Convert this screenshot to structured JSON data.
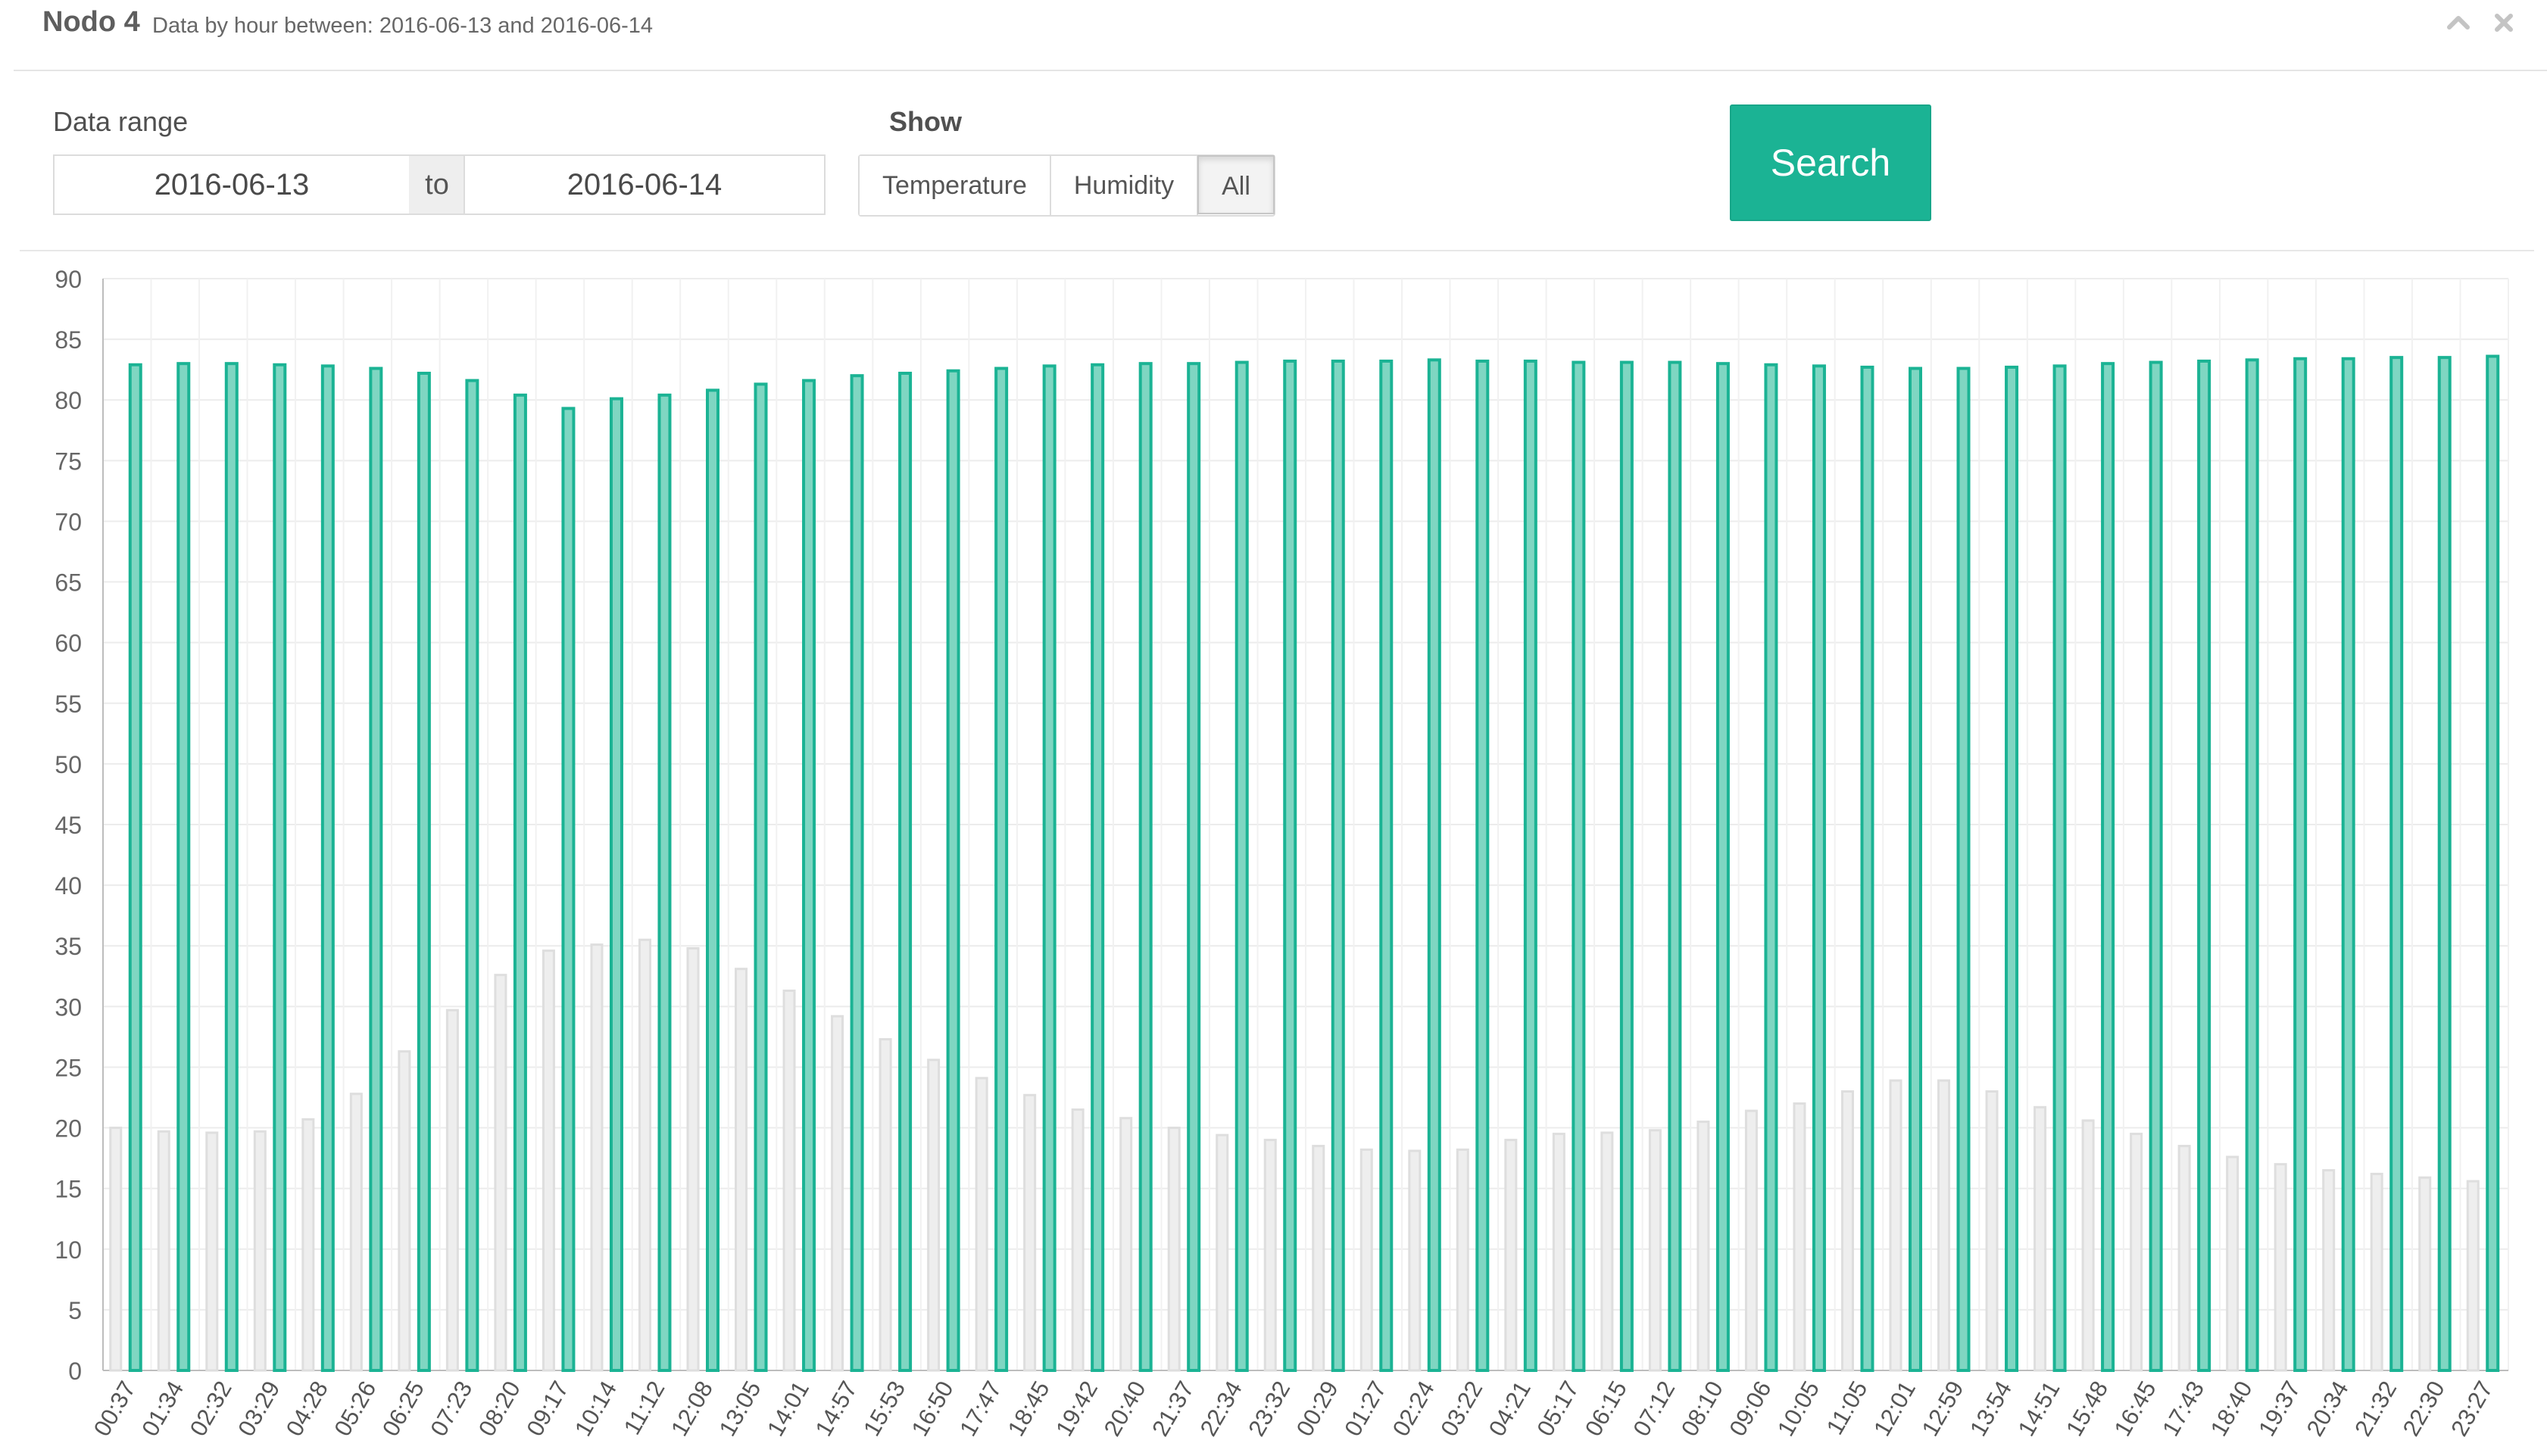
{
  "header": {
    "title": "Nodo 4",
    "subtitle": "Data by hour between: 2016-06-13 and 2016-06-14",
    "collapse_icon": "chevron-up-icon",
    "close_icon": "close-icon"
  },
  "form": {
    "range_label": "Data range",
    "from_value": "2016-06-13",
    "to_label": "to",
    "to_value": "2016-06-14",
    "show_label": "Show",
    "options": [
      "Temperature",
      "Humidity",
      "All"
    ],
    "selected": "All",
    "search_label": "Search"
  },
  "colors": {
    "humidity": "#1bb394",
    "temperature": "#dedede",
    "accent": "#1bb394"
  },
  "chart_data": {
    "type": "bar",
    "ylim": [
      0,
      90
    ],
    "yticks": [
      0,
      5,
      10,
      15,
      20,
      25,
      30,
      35,
      40,
      45,
      50,
      55,
      60,
      65,
      70,
      75,
      80,
      85,
      90
    ],
    "grid": true,
    "legend": "none",
    "categories": [
      "00:37",
      "01:34",
      "02:32",
      "03:29",
      "04:28",
      "05:26",
      "06:25",
      "07:23",
      "08:20",
      "09:17",
      "10:14",
      "11:12",
      "12:08",
      "13:05",
      "14:01",
      "14:57",
      "15:53",
      "16:50",
      "17:47",
      "18:45",
      "19:42",
      "20:40",
      "21:37",
      "22:34",
      "23:32",
      "00:29",
      "01:27",
      "02:24",
      "03:22",
      "04:21",
      "05:17",
      "06:15",
      "07:12",
      "08:10",
      "09:06",
      "10:05",
      "11:05",
      "12:01",
      "12:59",
      "13:54",
      "14:51",
      "15:48",
      "16:45",
      "17:43",
      "18:40",
      "19:37",
      "20:34",
      "21:32",
      "22:30",
      "23:27"
    ],
    "series": [
      {
        "values": [
          20.0,
          19.7,
          19.6,
          19.7,
          20.7,
          22.8,
          26.3,
          29.7,
          32.6,
          34.6,
          35.1,
          35.5,
          34.8,
          33.1,
          31.3,
          29.2,
          27.3,
          25.6,
          24.1,
          22.7,
          21.5,
          20.8,
          20.0,
          19.4,
          19.0,
          18.5,
          18.2,
          18.1,
          18.2,
          19.0,
          19.5,
          19.6,
          19.8,
          20.5,
          21.4,
          22.0,
          23.0,
          23.9,
          23.9,
          23.0,
          21.7,
          20.6,
          19.5,
          18.5,
          17.6,
          17.0,
          16.5,
          16.2,
          15.9,
          15.6
        ]
      },
      {
        "values": [
          82.9,
          83.0,
          83.0,
          82.9,
          82.8,
          82.6,
          82.2,
          81.6,
          80.4,
          79.3,
          80.1,
          80.4,
          80.8,
          81.3,
          81.6,
          82.0,
          82.2,
          82.4,
          82.6,
          82.8,
          82.9,
          83.0,
          83.0,
          83.1,
          83.2,
          83.2,
          83.2,
          83.3,
          83.2,
          83.2,
          83.1,
          83.1,
          83.1,
          83.0,
          82.9,
          82.8,
          82.7,
          82.6,
          82.6,
          82.7,
          82.8,
          83.0,
          83.1,
          83.2,
          83.3,
          83.4,
          83.4,
          83.5,
          83.5,
          83.6
        ]
      }
    ]
  }
}
